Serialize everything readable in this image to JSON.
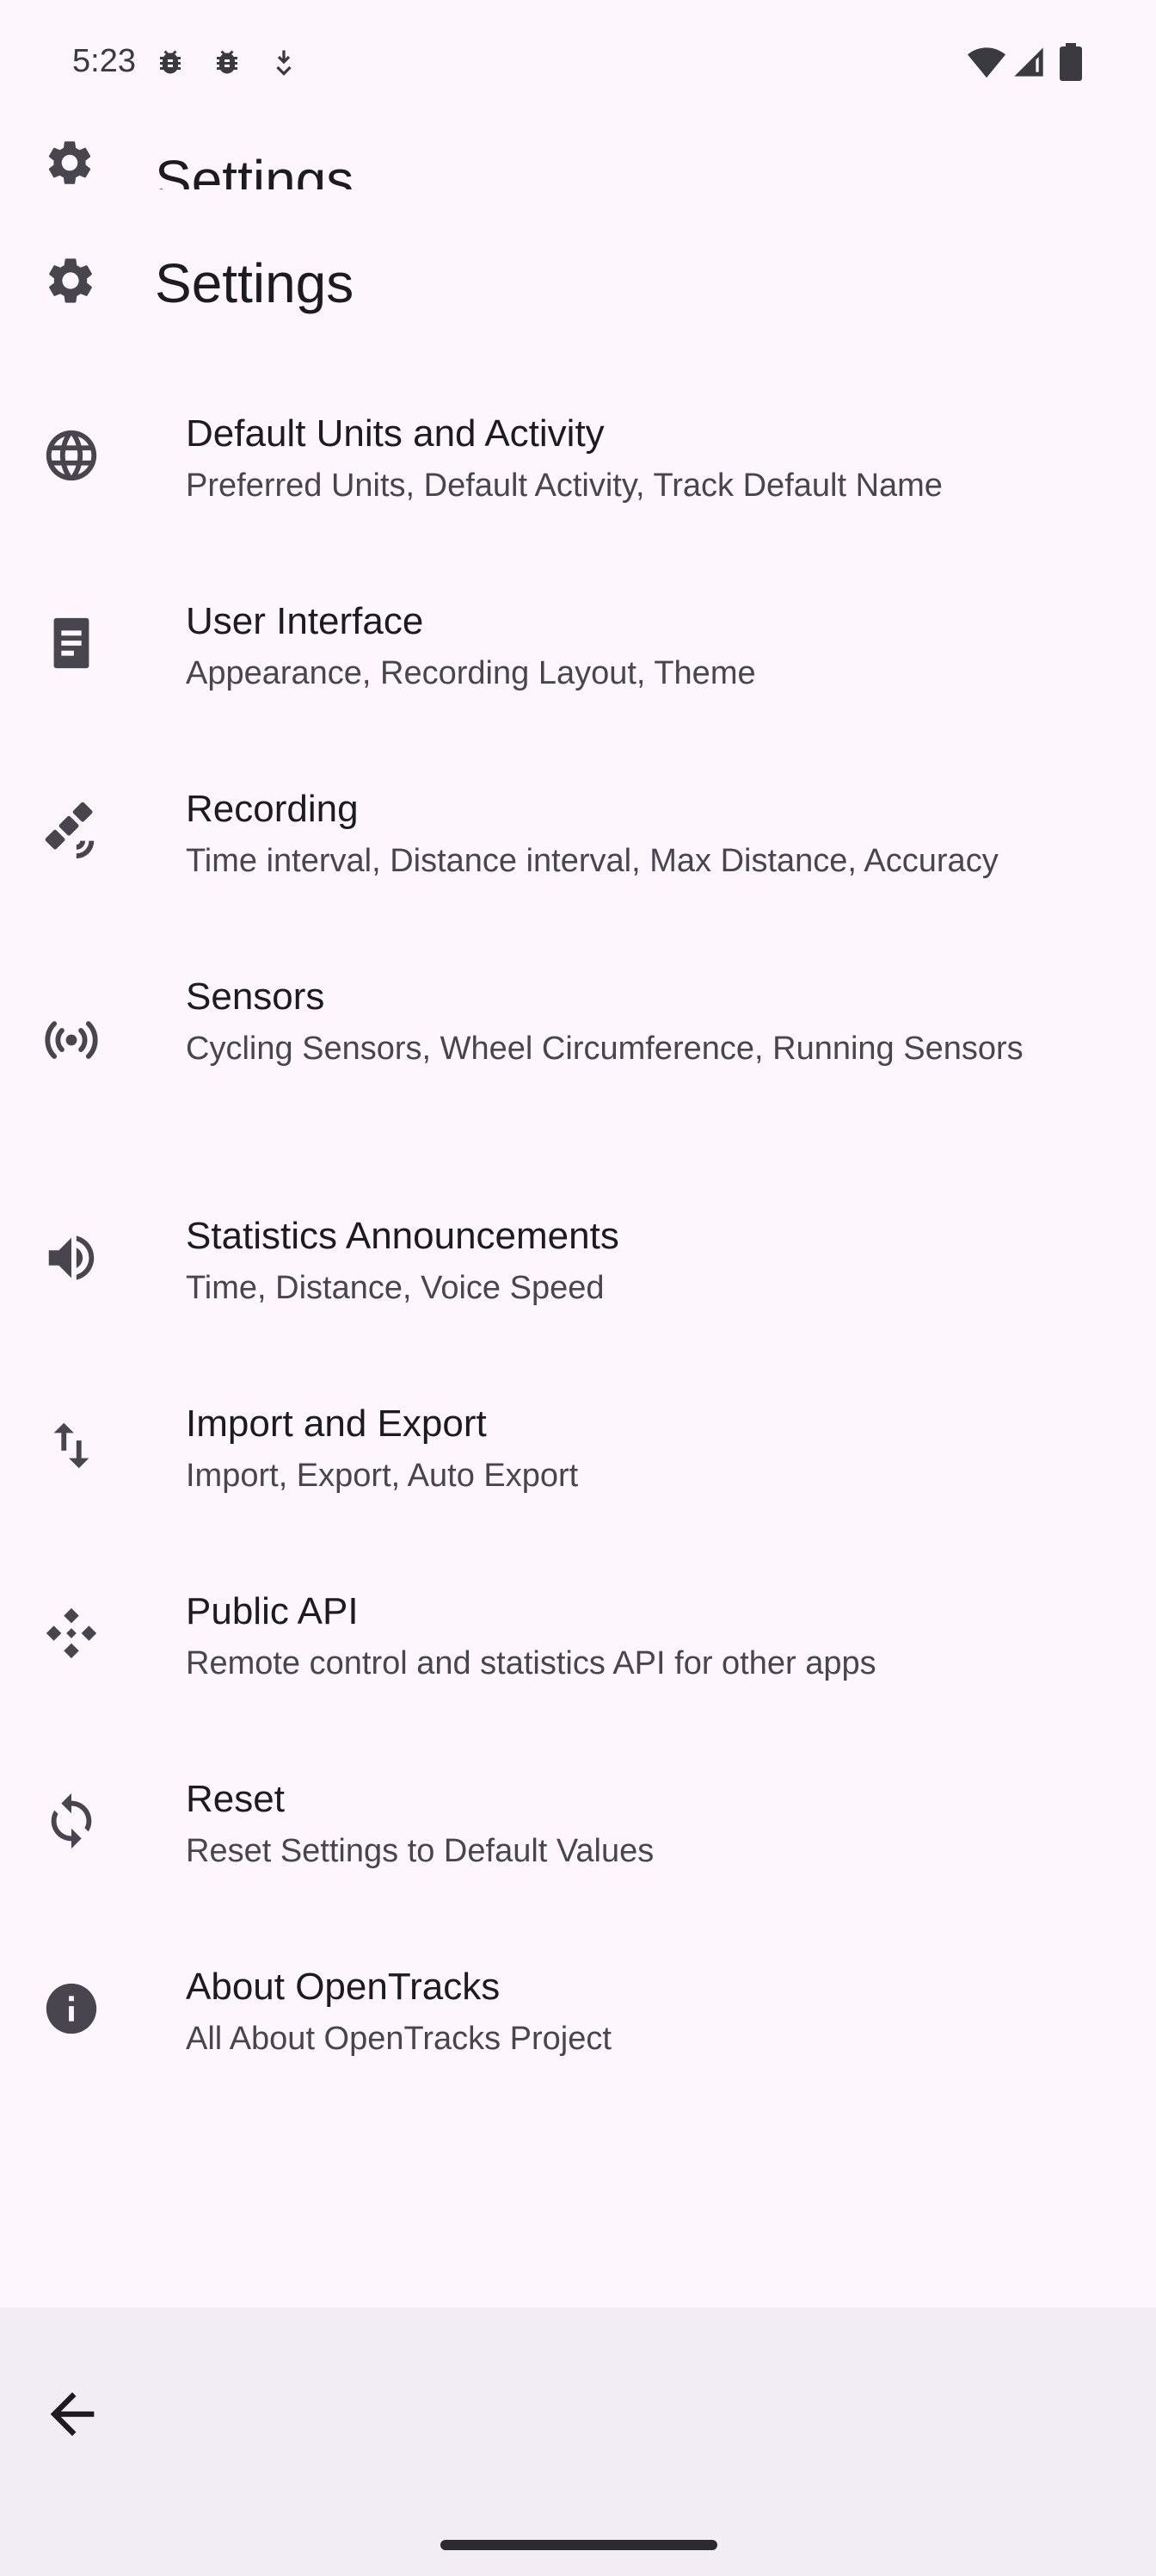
{
  "status_bar": {
    "time": "5:23",
    "left_icons": [
      "bug-icon",
      "bug-icon",
      "download-icon"
    ],
    "right_icons": [
      "wifi-icon",
      "cell-signal-icon",
      "battery-icon"
    ]
  },
  "header": {
    "title": "Settings",
    "icon": "gear-icon"
  },
  "settings": [
    {
      "title": "Default Units and Activity",
      "subtitle": "Preferred Units, Default Activity, Track Default Name",
      "icon": "globe-icon"
    },
    {
      "title": "User Interface",
      "subtitle": "Appearance, Recording Layout, Theme",
      "icon": "document-icon"
    },
    {
      "title": "Recording",
      "subtitle": "Time interval, Distance interval, Max Distance, Accuracy",
      "icon": "satellite-icon"
    },
    {
      "title": "Sensors",
      "subtitle": "Cycling Sensors, Wheel Circumference, Running Sensors",
      "icon": "sensors-icon"
    },
    {
      "title": "Statistics Announcements",
      "subtitle": "Time, Distance, Voice Speed",
      "icon": "volume-icon"
    },
    {
      "title": "Import and Export",
      "subtitle": "Import, Export, Auto Export",
      "icon": "import-export-icon"
    },
    {
      "title": "Public API",
      "subtitle": "Remote control and statistics API for other apps",
      "icon": "api-icon"
    },
    {
      "title": "Reset",
      "subtitle": "Reset Settings to Default Values",
      "icon": "reset-icon"
    },
    {
      "title": "About OpenTracks",
      "subtitle": "All About OpenTracks Project",
      "icon": "info-icon"
    }
  ],
  "navigation": {
    "back_icon": "back-arrow-icon"
  }
}
